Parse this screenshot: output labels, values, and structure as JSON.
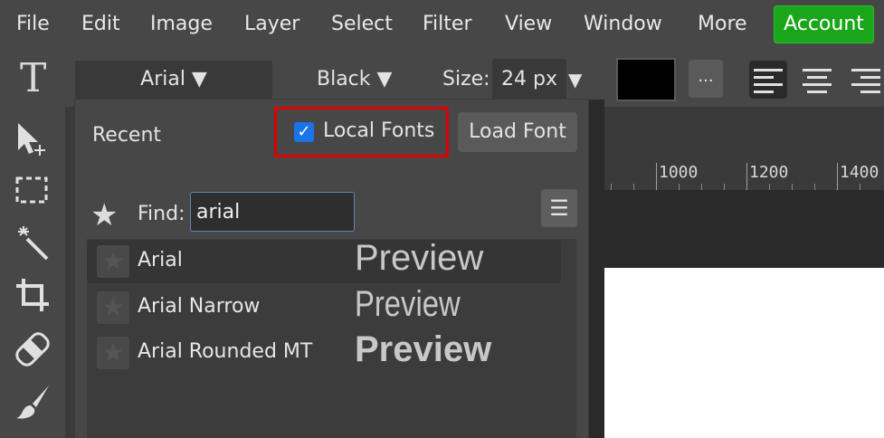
{
  "menu": {
    "items": [
      "File",
      "Edit",
      "Image",
      "Layer",
      "Select",
      "Filter",
      "View",
      "Window",
      "More"
    ],
    "account_label": "Account",
    "account_color": "#1aa61a"
  },
  "options": {
    "tool_icon": "T",
    "font_name": "Arial ▼",
    "weight": "Black ▼",
    "size_label": "Size:",
    "size_value": "24 px",
    "size_arrow": "▼",
    "color": "#000000",
    "more_label": "..."
  },
  "toolbar": {
    "tools": [
      "move-tool-icon",
      "marquee-select-icon",
      "magic-wand-icon",
      "crop-icon",
      "healing-brush-icon",
      "brush-icon"
    ]
  },
  "ruler": {
    "labels": [
      "1000",
      "1200",
      "1400"
    ]
  },
  "font_popup": {
    "recent_label": "Recent",
    "local_fonts_label": "Local Fonts",
    "local_fonts_checked": true,
    "load_font_label": "Load Font",
    "find_label": "Find:",
    "find_value": "arial",
    "menu_glyph": "☰",
    "fonts": [
      {
        "name": "Arial",
        "preview": "Preview"
      },
      {
        "name": "Arial Narrow",
        "preview": "Preview"
      },
      {
        "name": "Arial Rounded MT",
        "preview": "Preview"
      }
    ]
  }
}
